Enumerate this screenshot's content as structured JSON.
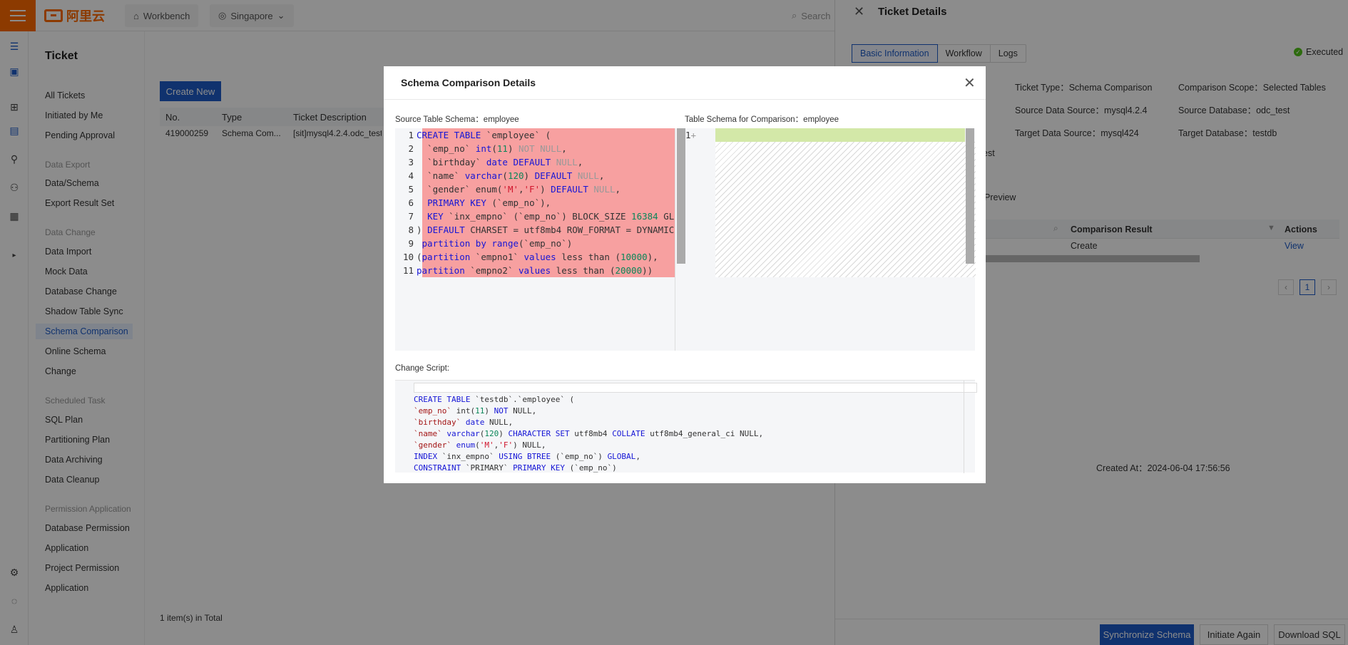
{
  "topbar": {
    "logo_text": "阿里云",
    "workbench": "Workbench",
    "region": "Singapore",
    "search_placeholder": "Search"
  },
  "nav": {
    "page_title": "Ticket",
    "items": [
      {
        "label": "All Tickets"
      },
      {
        "label": "Initiated by Me"
      },
      {
        "label": "Pending Approval"
      }
    ],
    "groups": [
      {
        "title": "Data Export",
        "items": [
          "Data/Schema",
          "Export Result Set"
        ]
      },
      {
        "title": "Data Change",
        "items": [
          "Data Import",
          "Mock Data",
          "Database Change",
          "Shadow Table Sync",
          "Schema Comparison",
          "Online Schema",
          "Change"
        ]
      },
      {
        "title": "Scheduled Task",
        "items": [
          "SQL Plan",
          "Partitioning Plan",
          "Data Archiving",
          "Data Cleanup"
        ]
      },
      {
        "title": "Permission Application",
        "items": [
          "Database Permission",
          "Application",
          "Project Permission",
          "Application"
        ]
      }
    ],
    "active_item": "Schema Comparison"
  },
  "main": {
    "create_button": "Create New",
    "columns": [
      "No.",
      "Type",
      "Ticket Description"
    ],
    "rows": [
      {
        "no": "419000259",
        "type": "Schema Com...",
        "desc": "[sit]mysql4.2.4.odc_test"
      }
    ],
    "total": "1 item(s) in Total"
  },
  "drawer": {
    "title": "Ticket Details",
    "tabs": [
      "Basic Information",
      "Workflow",
      "Logs"
    ],
    "status": "Executed",
    "fields": {
      "ticket_type": "Ticket Type：Schema Comparison",
      "comparison_scope": "Comparison Scope：Selected Tables",
      "source_data_source": "Source Data Source：mysql4.2.4",
      "source_database": "Source Database：odc_test",
      "target_data_source": "Target Data Source：mysql424",
      "target_database": "Target Database：testdb",
      "partial": "est"
    },
    "preview_tab": "Preview",
    "result_columns": [
      "Comparison Result",
      "Actions"
    ],
    "result_row": {
      "result": "Create",
      "action": "View"
    },
    "page": "1",
    "created_at": "Created At：2024-06-04 17:56:56",
    "footer_buttons": [
      "Synchronize Schema",
      "Initiate Again",
      "Download SQL"
    ]
  },
  "modal": {
    "title": "Schema Comparison Details",
    "source_label": "Source Table Schema：employee",
    "target_label": "Table Schema for Comparison：employee",
    "change_script_label": "Change Script:",
    "source_lines": [
      "CREATE TABLE `employee` (",
      "  `emp_no` int(11) NOT NULL,",
      "  `birthday` date DEFAULT NULL,",
      "  `name` varchar(120) DEFAULT NULL,",
      "  `gender` enum('M','F') DEFAULT NULL,",
      "  PRIMARY KEY (`emp_no`),",
      "  KEY `inx_empno` (`emp_no`) BLOCK_SIZE 16384 GL",
      ") DEFAULT CHARSET = utf8mb4 ROW_FORMAT = DYNAMIC",
      " partition by range(`emp_no`)",
      "(partition `empno1` values less than (10000),",
      "partition `empno2` values less than (20000))"
    ],
    "target_line_number": "1",
    "target_marker": "+",
    "change_script": [
      "CREATE TABLE `testdb`.`employee` (",
      "`emp_no` int(11) NOT NULL,",
      "`birthday` date NULL,",
      "`name` varchar(120) CHARACTER SET utf8mb4 COLLATE utf8mb4_general_ci NULL,",
      "`gender` enum('M','F') NULL,",
      "INDEX `inx_empno` USING BTREE (`emp_no`) GLOBAL,",
      "CONSTRAINT `PRIMARY` PRIMARY KEY (`emp_no`)"
    ]
  },
  "colors": {
    "brand": "#ff6a00",
    "primary": "#1e5cc8",
    "deleted": "#f7a0a0",
    "added": "#d3e8a8",
    "success": "#52c41a"
  }
}
